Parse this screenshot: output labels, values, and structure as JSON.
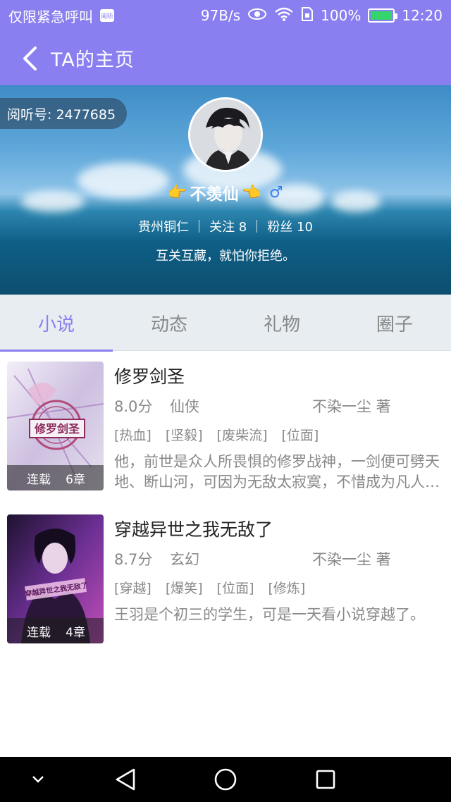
{
  "status_bar": {
    "notification_text": "仅限紧急呼叫",
    "app_badge": "阅听",
    "network_speed": "97B/s",
    "battery_percent": "100%",
    "battery_level": 1.0,
    "time": "12:20"
  },
  "header": {
    "title": "TA的主页"
  },
  "profile": {
    "reader_id": "阅听号: 2477685",
    "nickname": "不羡仙",
    "location": "贵州铜仁",
    "following": "关注 8",
    "followers": "粉丝 10",
    "bio": "互关互藏，就怕你拒绝。"
  },
  "tabs": [
    {
      "label": "小说",
      "active": true
    },
    {
      "label": "动态",
      "active": false
    },
    {
      "label": "礼物",
      "active": false
    },
    {
      "label": "圈子",
      "active": false
    }
  ],
  "books": [
    {
      "title": "修罗剑圣",
      "score": "8.0分",
      "genre": "仙侠",
      "author": "不染一尘 著",
      "tags": [
        "[热血]",
        "[坚毅]",
        "[废柴流]",
        "[位面]"
      ],
      "description": "他，前世是众人所畏惧的修罗战神，一剑便可劈天地、断山河，可因为无敌太寂寞，不惜成为凡人重新修炼……",
      "status": "连载",
      "chapters": "6章",
      "cover_colors": [
        "#e9e4f2",
        "#c7b6d8",
        "#d7d0e4"
      ]
    },
    {
      "title": "穿越异世之我无敌了",
      "score": "8.7分",
      "genre": "玄幻",
      "author": "不染一尘 著",
      "tags": [
        "[穿越]",
        "[爆笑]",
        "[位面]",
        "[修炼]"
      ],
      "description": "王羽是个初三的学生，可是一天看小说穿越了。",
      "status": "连载",
      "chapters": "4章",
      "cover_colors": [
        "#2a1a44",
        "#7b3aa6",
        "#c14fb9"
      ]
    }
  ]
}
